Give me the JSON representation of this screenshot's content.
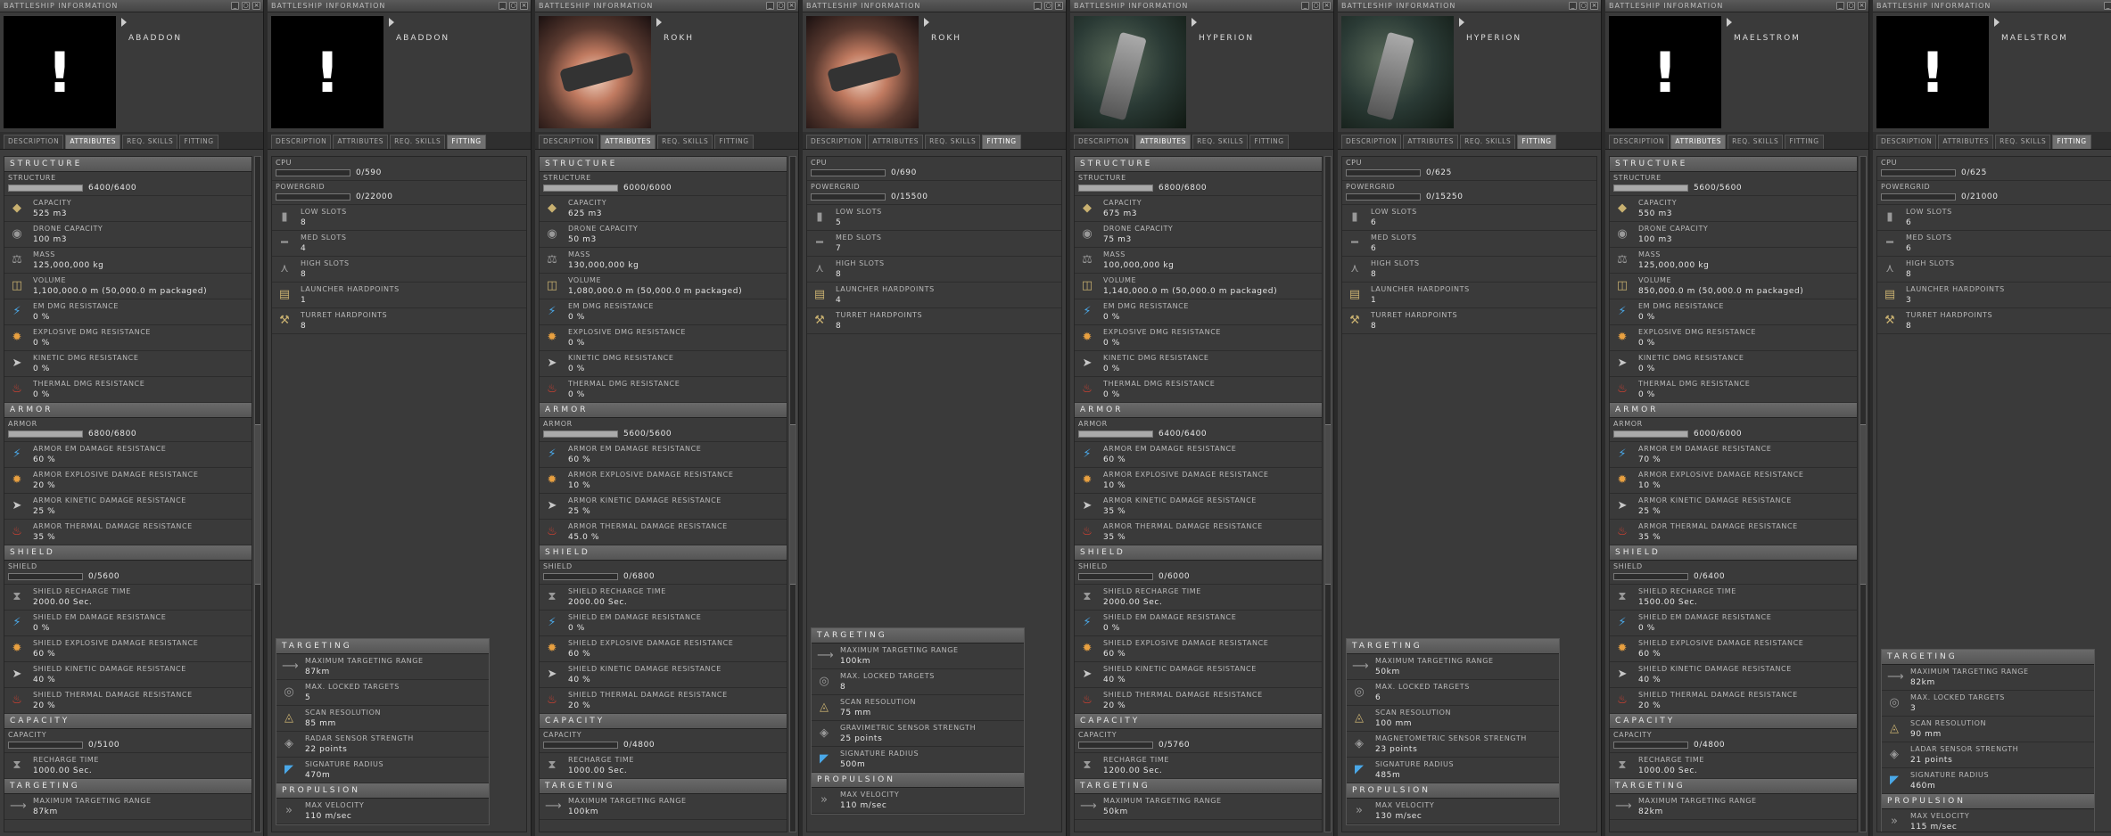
{
  "window_title": "BATTLESHIP INFORMATION",
  "tabs": [
    "DESCRIPTION",
    "ATTRIBUTES",
    "REQ. SKILLS",
    "FITTING"
  ],
  "section_names": {
    "structure": "STRUCTURE",
    "armor": "ARMOR",
    "shield": "SHIELD",
    "capacity": "CAPACITY",
    "targeting": "TARGETING",
    "propulsion": "PROPULSION"
  },
  "labels": {
    "structure": "STRUCTURE",
    "capacity": "CAPACITY",
    "drone": "DRONE CAPACITY",
    "mass": "MASS",
    "volume": "VOLUME",
    "em": "EM DMG RESISTANCE",
    "exp": "EXPLOSIVE DMG RESISTANCE",
    "kin": "KINETIC DMG RESISTANCE",
    "therm": "THERMAL DMG RESISTANCE",
    "armor": "ARMOR",
    "a_em": "ARMOR EM DAMAGE RESISTANCE",
    "a_exp": "ARMOR EXPLOSIVE DAMAGE RESISTANCE",
    "a_kin": "ARMOR KINETIC DAMAGE RESISTANCE",
    "a_therm": "ARMOR THERMAL DAMAGE RESISTANCE",
    "shield": "SHIELD",
    "recharge": "SHIELD RECHARGE TIME",
    "s_em": "SHIELD EM DAMAGE RESISTANCE",
    "s_exp": "SHIELD EXPLOSIVE DAMAGE RESISTANCE",
    "s_kin": "SHIELD KINETIC DAMAGE RESISTANCE",
    "s_therm": "SHIELD THERMAL DAMAGE RESISTANCE",
    "cap": "CAPACITY",
    "cap_recharge": "RECHARGE TIME",
    "max_target": "MAXIMUM TARGETING RANGE",
    "cpu": "CPU",
    "powergrid": "POWERGRID",
    "low": "LOW SLOTS",
    "med": "MED SLOTS",
    "high": "HIGH SLOTS",
    "launcher": "LAUNCHER HARDPOINTS",
    "turret": "TURRET HARDPOINTS",
    "t_range": "MAXIMUM TARGETING RANGE",
    "t_locked": "MAX. LOCKED TARGETS",
    "t_scan": "SCAN RESOLUTION",
    "t_sig": "SIGNATURE RADIUS",
    "p_vel": "MAX VELOCITY"
  },
  "ships": [
    {
      "name": "ABADDON",
      "image": "missing",
      "structure": "6400/6400",
      "structure_frac": 1.0,
      "capacity": "525 m3",
      "drone": "100 m3",
      "mass": "125,000,000 kg",
      "volume": "1,100,000.0 m (50,000.0 m packaged)",
      "em": "0 %",
      "exp": "0 %",
      "kin": "0 %",
      "therm": "0 %",
      "armor": "6800/6800",
      "armor_frac": 1.0,
      "a_em": "60 %",
      "a_exp": "20 %",
      "a_kin": "25 %",
      "a_therm": "35 %",
      "shield": "0/5600",
      "recharge": "2000.00 Sec.",
      "s_em": "0 %",
      "s_exp": "60 %",
      "s_kin": "40 %",
      "s_therm": "20 %",
      "cap": "0/5100",
      "cap_recharge": "1000.00 Sec.",
      "cpu": "0/590",
      "powergrid": "0/22000",
      "low": "8",
      "med": "4",
      "high": "8",
      "launcher": "1",
      "turret": "8",
      "t_range": "87km",
      "t_locked": "5",
      "t_scan": "85 mm",
      "sensor_label": "RADAR SENSOR STRENGTH",
      "sensor": "22 points",
      "t_sig": "470m",
      "p_vel": "110 m/sec"
    },
    {
      "name": "ROKH",
      "image": "nebula",
      "structure": "6000/6000",
      "structure_frac": 1.0,
      "capacity": "625 m3",
      "drone": "50 m3",
      "mass": "130,000,000 kg",
      "volume": "1,080,000.0 m (50,000.0 m packaged)",
      "em": "0 %",
      "exp": "0 %",
      "kin": "0 %",
      "therm": "0 %",
      "armor": "5600/5600",
      "armor_frac": 1.0,
      "a_em": "60 %",
      "a_exp": "10 %",
      "a_kin": "25 %",
      "a_therm": "45.0 %",
      "shield": "0/6800",
      "recharge": "2000.00 Sec.",
      "s_em": "0 %",
      "s_exp": "60 %",
      "s_kin": "40 %",
      "s_therm": "20 %",
      "cap": "0/4800",
      "cap_recharge": "1000.00 Sec.",
      "cpu": "0/690",
      "powergrid": "0/15500",
      "low": "5",
      "med": "7",
      "high": "8",
      "launcher": "4",
      "turret": "8",
      "t_range": "100km",
      "t_locked": "8",
      "t_scan": "75 mm",
      "sensor_label": "GRAVIMETRIC SENSOR STRENGTH",
      "sensor": "25 points",
      "t_sig": "500m",
      "p_vel": "110 m/sec"
    },
    {
      "name": "HYPERION",
      "image": "green",
      "structure": "6800/6800",
      "structure_frac": 1.0,
      "capacity": "675 m3",
      "drone": "75 m3",
      "mass": "100,000,000 kg",
      "volume": "1,140,000.0 m (50,000.0 m packaged)",
      "em": "0 %",
      "exp": "0 %",
      "kin": "0 %",
      "therm": "0 %",
      "armor": "6400/6400",
      "armor_frac": 1.0,
      "a_em": "60 %",
      "a_exp": "10 %",
      "a_kin": "35 %",
      "a_therm": "35 %",
      "shield": "0/6000",
      "recharge": "2000.00 Sec.",
      "s_em": "0 %",
      "s_exp": "60 %",
      "s_kin": "40 %",
      "s_therm": "20 %",
      "cap": "0/5760",
      "cap_recharge": "1200.00 Sec.",
      "cpu": "0/625",
      "powergrid": "0/15250",
      "low": "6",
      "med": "6",
      "high": "8",
      "launcher": "1",
      "turret": "8",
      "t_range": "50km",
      "t_locked": "6",
      "t_scan": "100 mm",
      "sensor_label": "MAGNETOMETRIC SENSOR STRENGTH",
      "sensor": "23 points",
      "t_sig": "485m",
      "p_vel": "130 m/sec"
    },
    {
      "name": "MAELSTROM",
      "image": "missing",
      "structure": "5600/5600",
      "structure_frac": 1.0,
      "capacity": "550 m3",
      "drone": "100 m3",
      "mass": "125,000,000 kg",
      "volume": "850,000.0 m (50,000.0 m packaged)",
      "em": "0 %",
      "exp": "0 %",
      "kin": "0 %",
      "therm": "0 %",
      "armor": "6000/6000",
      "armor_frac": 1.0,
      "a_em": "70 %",
      "a_exp": "10 %",
      "a_kin": "25 %",
      "a_therm": "35 %",
      "shield": "0/6400",
      "recharge": "1500.00 Sec.",
      "s_em": "0 %",
      "s_exp": "60 %",
      "s_kin": "40 %",
      "s_therm": "20 %",
      "cap": "0/4800",
      "cap_recharge": "1000.00 Sec.",
      "cpu": "0/625",
      "powergrid": "0/21000",
      "low": "6",
      "med": "6",
      "high": "8",
      "launcher": "3",
      "turret": "8",
      "t_range": "82km",
      "t_locked": "3",
      "t_scan": "90 mm",
      "sensor_label": "LADAR SENSOR STRENGTH",
      "sensor": "21 points",
      "t_sig": "460m",
      "p_vel": "115 m/sec"
    }
  ]
}
